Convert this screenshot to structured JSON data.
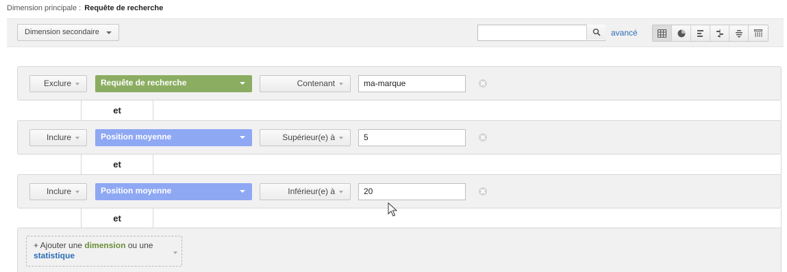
{
  "primary_dimension": {
    "label": "Dimension principale :",
    "value": "Requête de recherche"
  },
  "toolbar": {
    "secondary_dimension_label": "Dimension secondaire",
    "search_value": "",
    "advanced_link": "avancé",
    "view_icons": [
      "table-view-icon",
      "pie-view-icon",
      "performance-view-icon",
      "comparison-view-icon",
      "term-cloud-view-icon",
      "pivot-view-icon"
    ]
  },
  "filters": [
    {
      "mode": "Exclure",
      "dimension": "Requête de recherche",
      "dimension_color": "#8bad62",
      "operator": "Contenant",
      "value": "ma-marque"
    },
    {
      "mode": "Inclure",
      "dimension": "Position moyenne",
      "dimension_color": "#8fa8f4",
      "operator": "Supérieur(e) à",
      "value": "5"
    },
    {
      "mode": "Inclure",
      "dimension": "Position moyenne",
      "dimension_color": "#8fa8f4",
      "operator": "Inférieur(e) à",
      "value": "20"
    }
  ],
  "and_label": "et",
  "add_condition": {
    "prefix": "+ Ajouter une ",
    "dimension": "dimension",
    "middle": " ou une",
    "statistic": "statistique"
  }
}
